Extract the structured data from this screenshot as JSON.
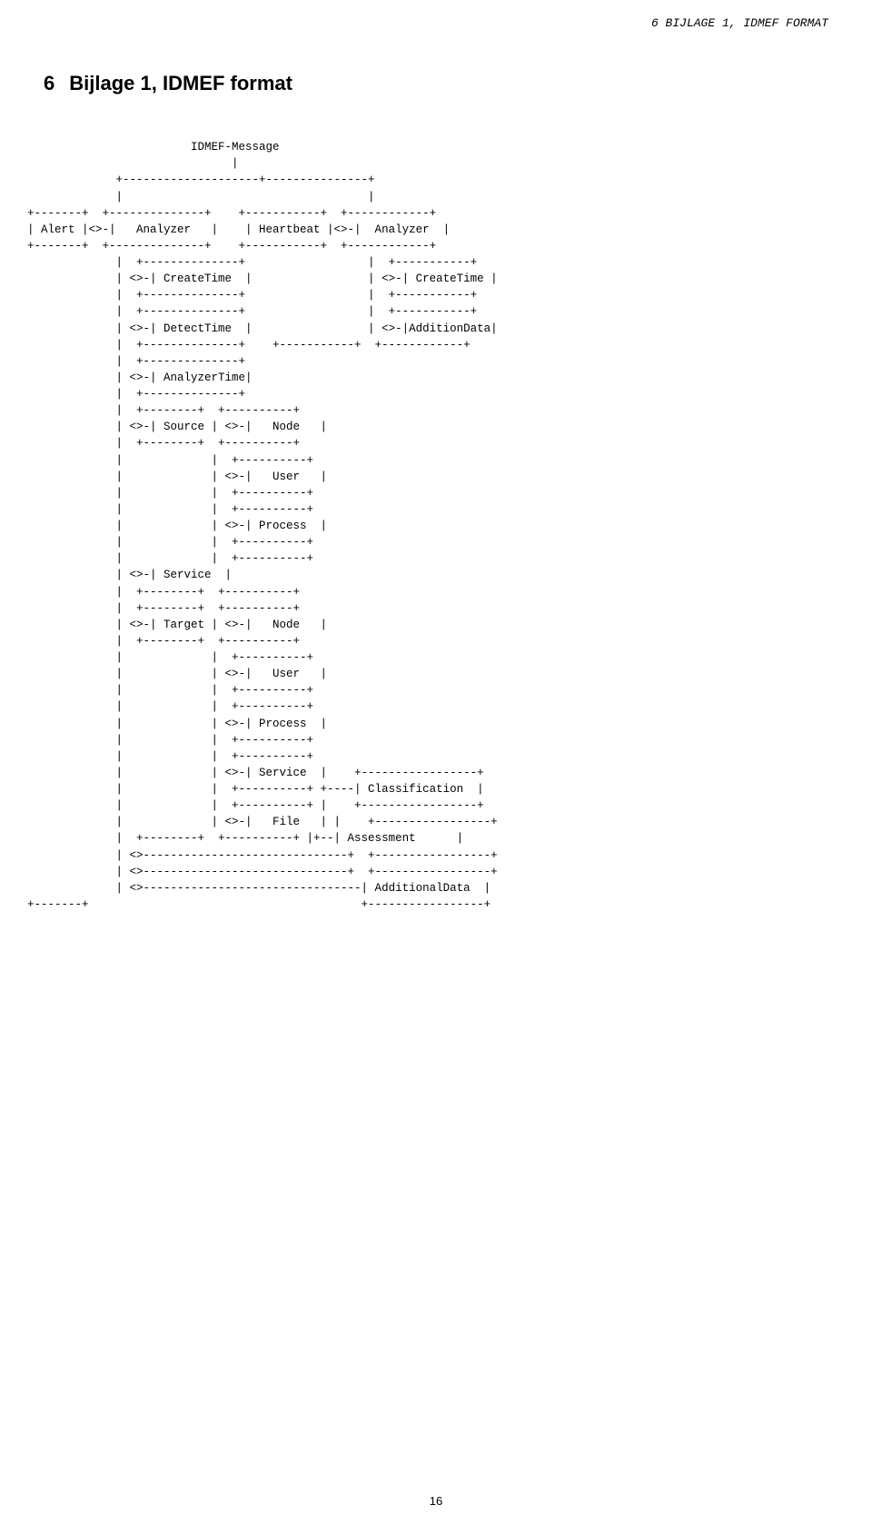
{
  "header": {
    "text": "6   BIJLAGE 1, IDMEF FORMAT"
  },
  "chapter": {
    "number": "6",
    "title": "Bijlage 1, IDMEF format"
  },
  "diagram": {
    "content": "                        IDMEF-Message\n                              |\n             +--------------------+---------------+\n             |                                    |\n+-------+  +--------------+    +-----------+  +------------+\n| Alert |<>-|   Analyzer   |    | Heartbeat |<>-|  Analyzer  |\n+-------+  +--------------+    +-----------+  +------------+\n             |  +--------------+    |             |  +-----------+\n             | <>-| CreateTime  |    |             | <>-| CreateTime |\n             |  +--------------+    |             |  +-----------+\n             |  +--------------+    |             |  +-----------+\n             | <>-| DetectTime  |    |             | <>-|AdditionData|\n             |  +--------------+    +-----------+  +------------+\n             |  +--------------+\n             | <>-| AnalyzerTime|\n             |  +--------------+\n             |  +--------+  +----------+\n             | <>-| Source | <>-|   Node   |\n             |  +--------+  +----------+\n             |             |  +----------+\n             |             | <>-|   User   |\n             |             |  +----------+\n             |             |  +----------+\n             |             | <>-| Process  |\n             |             |  +----------+\n             |             |  +----------+\n             |             | <>-| Service  |\n             |  +--------+  +----------+\n             |  +--------+  +----------+\n             | <>-| Target | <>-|   Node   |\n             |  +--------+  +----------+\n             |             |  +----------+\n             |             | <>-|   User   |\n             |             |  +----------+\n             |             |  +----------+\n             |             | <>-| Process  |\n             |             |  +----------+\n             |             |  +----------+\n             |             | <>-| Service  |    +-----------------+\n             |             |  +----------+ +----| Classification  |\n             |             |  +----------+ |    +-----------------+\n             |             | <>-|   File   | |    +-----------------+\n             |  +--------+  +----------+ |+--| Assessment      |\n             | <>------------------------------+  +-----------------+\n             | <>------------------------------+  +-----------------+\n             | <>--------------------------------| AdditionalData  |\n+-------+                                        +-----------------+"
  },
  "footer": {
    "page_number": "16"
  }
}
